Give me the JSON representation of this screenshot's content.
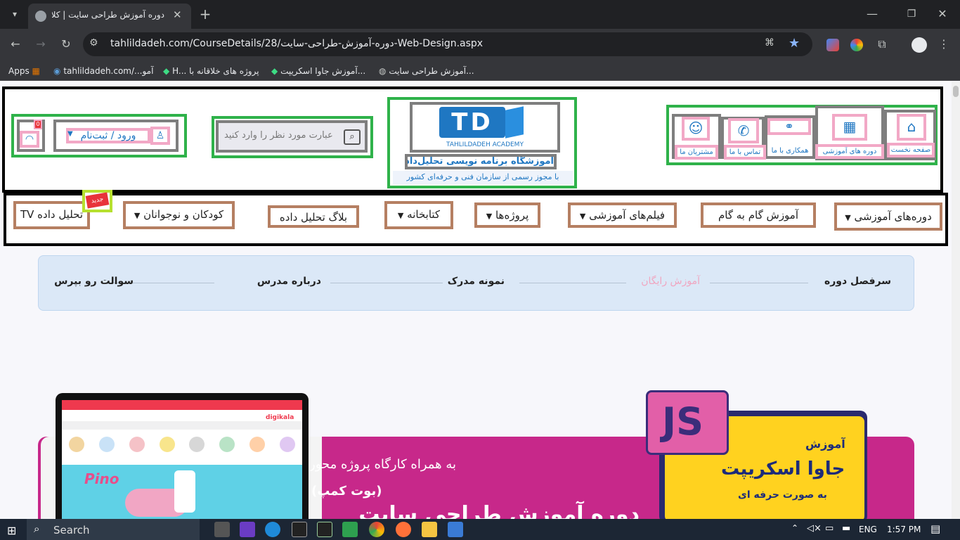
{
  "browser": {
    "tab_title": "دوره آموزش طراحی سایت | کلاس",
    "url": "tahlildadeh.com/CourseDetails/28/دوره-آموزش-طراحی-سایت-Web-Design.aspx",
    "bookmarks": [
      "Apps",
      "tahlildadeh.com/...آمو",
      "H... پروژه های خلاقانه با",
      "آموزش جاوا اسکریپت...",
      "آموزش طراحی سایت..."
    ]
  },
  "header": {
    "top_links": [
      "صفحه نخست",
      "دوره های آموزشی",
      "همکاری با ما",
      "تماس با ما",
      "مشتریان ما"
    ],
    "logo_text": "TAHLILDADEH ACADEMY",
    "academy_name": "آموزشگاه برنامه نویسی تحلیل‌داده",
    "academy_sub": "با مجوز رسمی از سازمان فنی و حرفه‌ای کشور",
    "search_placeholder": "عبارت مورد نظر را وارد کنید",
    "login_label": "ورود / ثبت‌نام",
    "cart_count": "0"
  },
  "nav": {
    "items": [
      "دوره‌های آموزشی",
      "آموزش گام به گام",
      "فیلم‌های آموزشی",
      "پروژه‌ها",
      "کتابخانه",
      "بلاگ تحلیل داده",
      "کودکان و نوجوانان",
      "تحلیل داده TV"
    ],
    "new_badge": "جدید"
  },
  "course_tabs": [
    "سرفصل دوره",
    "آموزش رایگان",
    "نمونه مدرک",
    "درباره مدرس",
    "سوالت رو بپرس"
  ],
  "banner": {
    "js_label": "JS",
    "title_small": "آموزش",
    "title_big": "جاوا اسکریپت",
    "title_sub": "به صورت حرفه ای",
    "line1": "به همراه کارگاه پروژه محور",
    "line2": "(بوت کمپ)",
    "line3": "دوره آموزش طراحی سایت",
    "screen_brand": "digikala",
    "screen_product": "Pino"
  },
  "taskbar": {
    "search_label": "Search",
    "lang": "ENG",
    "time": "1:57 PM"
  },
  "colors": {
    "brand_blue": "#1f77c2",
    "banner_pink": "#c7288a",
    "js_yellow": "#ffd21f"
  }
}
